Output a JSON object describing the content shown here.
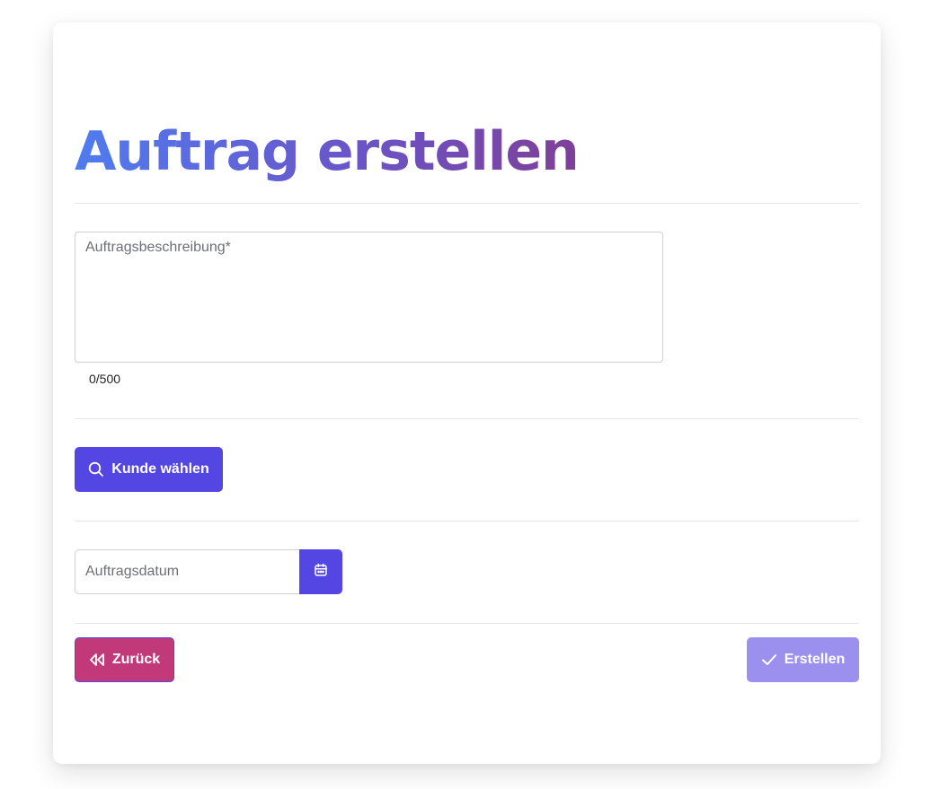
{
  "page": {
    "title": "Auftrag erstellen"
  },
  "description": {
    "placeholder": "Auftragsbeschreibung*",
    "value": "",
    "counter": "0/500"
  },
  "customer": {
    "button_label": "Kunde wählen",
    "icon": "search-icon"
  },
  "order_date": {
    "placeholder": "Auftragsdatum",
    "value": "",
    "calendar_icon": "calendar-icon"
  },
  "footer": {
    "back_label": "Zurück",
    "back_icon": "double-chevron-left-icon",
    "create_label": "Erstellen",
    "create_icon": "check-icon"
  },
  "colors": {
    "primary": "#5446e2",
    "primary_disabled": "#9b90ee",
    "back_button": "#c2397a",
    "title_gradient_start": "#4f7cf0",
    "title_gradient_end": "#7e3f98"
  }
}
